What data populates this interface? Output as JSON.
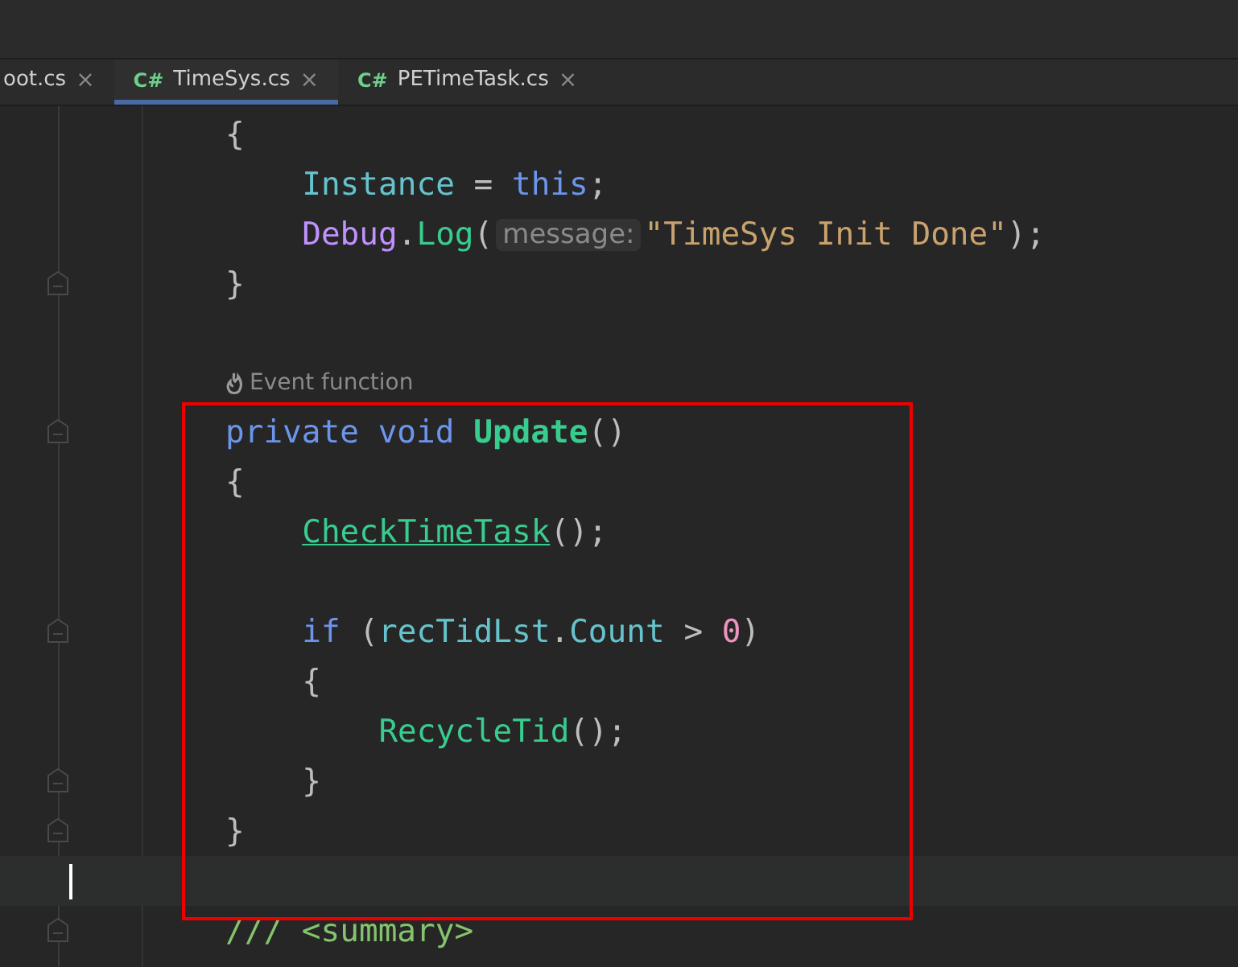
{
  "tabs": [
    {
      "label": "oot.cs",
      "close": "×",
      "selected": false
    },
    {
      "icon": "C#",
      "label": "TimeSys.cs",
      "close": "×",
      "selected": true
    },
    {
      "icon": "C#",
      "label": "PETimeTask.cs",
      "close": "×",
      "selected": false
    }
  ],
  "lines": [
    {
      "kind": "code",
      "fold": false,
      "tokens": [
        {
          "kind": "punct",
          "text": "{"
        }
      ]
    },
    {
      "kind": "block",
      "children": [
        {
          "kind": "code",
          "fold": false,
          "tokens": [
            {
              "kind": "field",
              "text": "Instance"
            },
            {
              "kind": "punct",
              "text": " = "
            },
            {
              "kind": "keyword",
              "text": "this"
            },
            {
              "kind": "punct",
              "text": ";"
            }
          ]
        },
        {
          "kind": "code",
          "fold": false,
          "tokens": [
            {
              "kind": "type",
              "text": "Debug"
            },
            {
              "kind": "punct",
              "text": "."
            },
            {
              "kind": "method",
              "text": "Log"
            },
            {
              "kind": "punct",
              "text": "("
            },
            {
              "kind": "inlay",
              "text": "message:"
            },
            {
              "kind": "string",
              "text": "\"TimeSys Init Done\""
            },
            {
              "kind": "punct",
              "text": ");"
            }
          ]
        }
      ]
    },
    {
      "kind": "code",
      "fold": true,
      "tokens": [
        {
          "kind": "punct",
          "text": "}"
        }
      ]
    },
    {
      "kind": "code",
      "fold": false
    },
    {
      "kind": "hint",
      "fold": false,
      "tokens": [
        {
          "kind": "hint",
          "text": "Event function"
        }
      ]
    },
    {
      "kind": "code",
      "fold": true,
      "tokens": [
        {
          "kind": "keyword",
          "text": "private void"
        },
        {
          "kind": "decl",
          "text": " Update"
        },
        {
          "kind": "punct",
          "text": "()"
        }
      ]
    },
    {
      "kind": "code",
      "fold": false,
      "tokens": [
        {
          "kind": "punct",
          "text": "{"
        }
      ]
    },
    {
      "kind": "block",
      "children": [
        {
          "kind": "code",
          "fold": false,
          "tokens": [
            {
              "kind": "link",
              "text": "CheckTimeTask"
            },
            {
              "kind": "punct",
              "text": "();"
            }
          ]
        },
        {
          "kind": "code",
          "fold": false
        },
        {
          "kind": "code",
          "fold": true,
          "tokens": [
            {
              "kind": "keyword",
              "text": "if"
            },
            {
              "kind": "punct",
              "text": " ("
            },
            {
              "kind": "field",
              "text": "recTidLst"
            },
            {
              "kind": "punct",
              "text": "."
            },
            {
              "kind": "field",
              "text": "Count"
            },
            {
              "kind": "punct",
              "text": " > "
            },
            {
              "kind": "number",
              "text": "0"
            },
            {
              "kind": "punct",
              "text": ")"
            }
          ]
        },
        {
          "kind": "code",
          "fold": false,
          "tokens": [
            {
              "kind": "punct",
              "text": "{"
            }
          ]
        },
        {
          "kind": "block",
          "children": [
            {
              "kind": "code",
              "fold": false,
              "tokens": [
                {
                  "kind": "method",
                  "text": "RecycleTid"
                },
                {
                  "kind": "punct",
                  "text": "();"
                }
              ]
            }
          ]
        },
        {
          "kind": "code",
          "fold": true,
          "tokens": [
            {
              "kind": "punct",
              "text": "}"
            }
          ]
        }
      ]
    },
    {
      "kind": "code",
      "fold": true,
      "tokens": [
        {
          "kind": "punct",
          "text": "}"
        }
      ]
    },
    {
      "kind": "current",
      "fold": false
    },
    {
      "kind": "code",
      "fold": true,
      "tokens": [
        {
          "kind": "comment",
          "text": "/// "
        },
        {
          "kind": "tag",
          "text": "<summary>"
        }
      ]
    }
  ]
}
